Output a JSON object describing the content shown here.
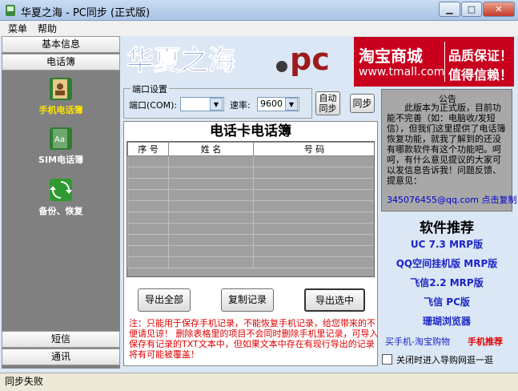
{
  "window": {
    "title": "华夏之海 - PC同步 (正式版)"
  },
  "menu": {
    "items": [
      "菜单",
      "帮助"
    ]
  },
  "sidebar": {
    "top_tabs": [
      "基本信息",
      "电话簿"
    ],
    "items": [
      {
        "label": "手机电话簿",
        "icon": "phonebook-icon",
        "active": true
      },
      {
        "label": "SIM电话簿",
        "icon": "sim-card-icon",
        "active": false
      },
      {
        "label": "备份、恢复",
        "icon": "backup-restore-icon",
        "active": false
      }
    ],
    "bottom_tabs": [
      "短信",
      "通讯"
    ]
  },
  "logo": {
    "text": "华夏之海",
    "suffix": "pc"
  },
  "ad": {
    "brand": "淘宝商城",
    "url": "www.tmall.com",
    "slogan1": "品质保证！",
    "slogan2": "值得信赖！"
  },
  "port": {
    "group_label": "端口设置",
    "port_label": "端口(COM):",
    "port_value": "",
    "rate_label": "速率:",
    "rate_value": "9600",
    "auto_sync": "自动\n同步",
    "sync": "同步"
  },
  "phonebook": {
    "title": "电话卡电话簿",
    "columns": [
      "序  号",
      "姓  名",
      "号  码"
    ],
    "buttons": {
      "export_all": "导出全部",
      "copy": "复制记录",
      "export_selected": "导出选中"
    },
    "note": "注：只能用于保存手机记录，不能恢复手机记录，给您带来的不便请见谅！    删除表格里的项目不会同时删除手机里记录，可导入保存有记录的TXT文本中，但如果文本中存在有现行导出的记录将有可能被覆盖！"
  },
  "notice": {
    "title": "公告",
    "body": "此版本为正式版，目前功能不完善（如：电脑收/发短信），但我们这里提供了电话簿恢复功能，就我了解到的还没有哪款软件有这个功能吧。呵呵，有什么意见提议的大家可以发信息告诉我！问题反馈、提意见：",
    "email": "345076455@qq.com",
    "copy_link": "点击复制"
  },
  "recommend": {
    "title": "软件推荐",
    "items": [
      "UC 7.3 MRP版",
      "QQ空间挂机版 MRP版",
      "飞信2.2 MRP版",
      "飞信 PC版",
      "珊瑚浏览器"
    ],
    "buy_link": "买手机-淘宝购物",
    "phone_rec": "手机推荐",
    "checkbox_label": "关闭时进入导购网逛一逛"
  },
  "status": {
    "text": "同步失败"
  },
  "colors": {
    "ad_red": "#c8001e",
    "link_blue": "#1a24c8",
    "note_red": "#e00000",
    "sidebar_gray": "#808080"
  }
}
